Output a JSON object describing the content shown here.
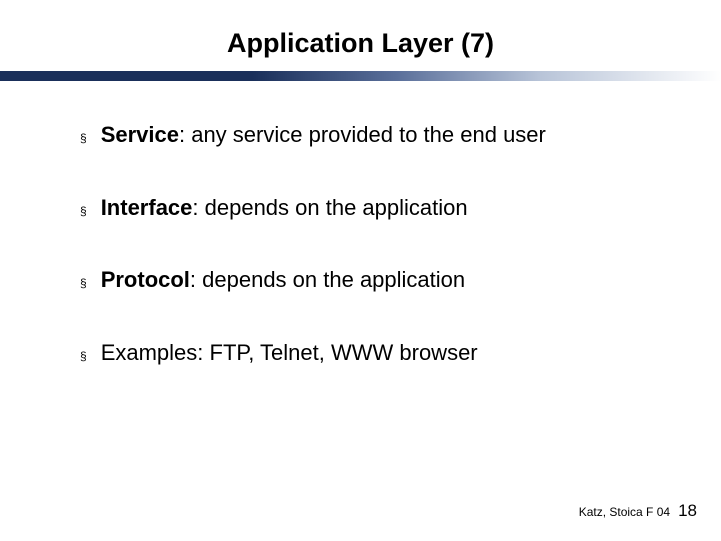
{
  "title": "Application Layer (7)",
  "bullets": [
    {
      "label": "Service",
      "text": ": any service provided to the end user"
    },
    {
      "label": "Interface",
      "text": ": depends on the application"
    },
    {
      "label": "Protocol",
      "text": ": depends on the application"
    },
    {
      "label": "Examples",
      "text": ": FTP, Telnet, WWW browser",
      "plain": true
    }
  ],
  "footer": {
    "credit": "Katz, Stoica F 04",
    "page": "18"
  }
}
